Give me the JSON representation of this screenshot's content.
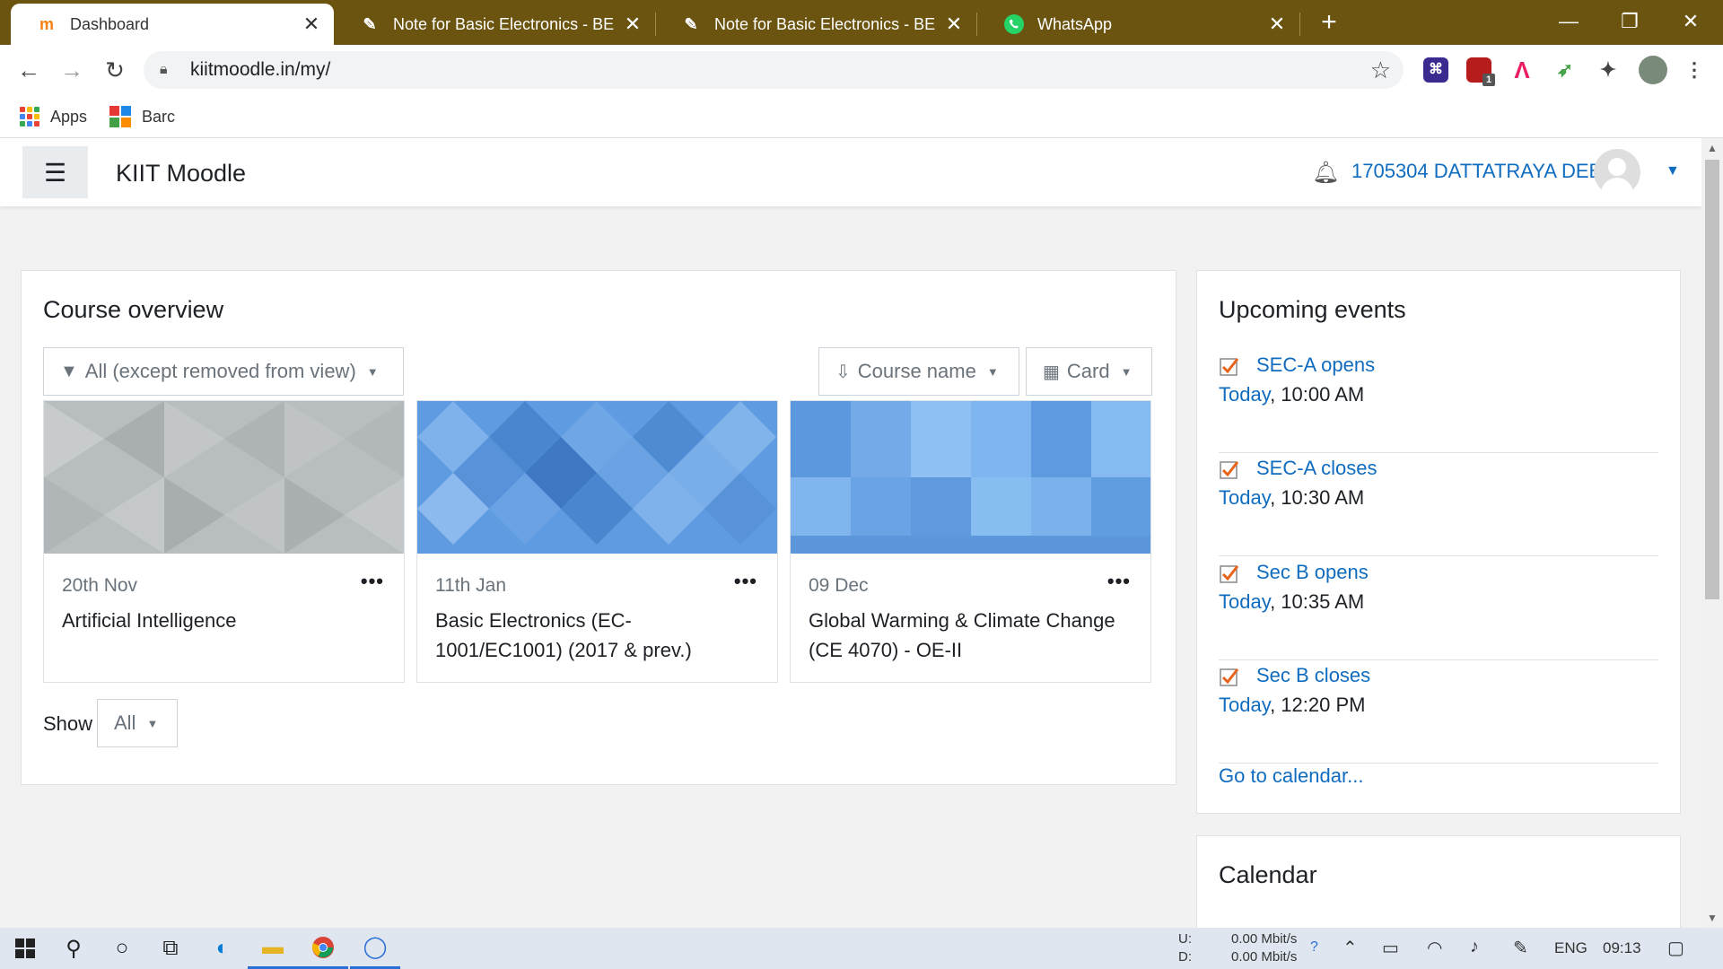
{
  "browser": {
    "tabs": [
      {
        "title": "Dashboard",
        "active": true
      },
      {
        "title": "Note for Basic Electronics - BE by",
        "active": false
      },
      {
        "title": "Note for Basic Electronics - BE By",
        "active": false
      },
      {
        "title": "WhatsApp",
        "active": false
      }
    ],
    "url": "kiitmoodle.in/my/",
    "bookmarks": [
      {
        "label": "Apps"
      },
      {
        "label": "Barc"
      }
    ],
    "extension_badge": "1"
  },
  "moodle": {
    "site_name": "KIIT Moodle",
    "user_name": "1705304 DATTATRAYA DEB"
  },
  "course_overview": {
    "title": "Course overview",
    "filter_label": "All (except removed from view)",
    "sort_label": "Course name",
    "view_label": "Card",
    "courses": [
      {
        "date": "20th Nov",
        "name": "Artificial Intelligence"
      },
      {
        "date": "11th Jan",
        "name": "Basic Electronics (EC-1001/EC1001) (2017 & prev.)"
      },
      {
        "date": "09 Dec",
        "name": "Global Warming & Climate Change (CE 4070) - OE-II"
      }
    ],
    "show_label": "Show",
    "show_value": "All"
  },
  "upcoming_events": {
    "title": "Upcoming events",
    "events": [
      {
        "name": "SEC-A opens",
        "day": "Today",
        "time": ", 10:00 AM"
      },
      {
        "name": "SEC-A closes",
        "day": "Today",
        "time": ", 10:30 AM"
      },
      {
        "name": "Sec B opens",
        "day": "Today",
        "time": ", 10:35 AM"
      },
      {
        "name": "Sec B closes",
        "day": "Today",
        "time": ", 12:20 PM"
      }
    ],
    "calendar_link": "Go to calendar..."
  },
  "calendar_block": {
    "title": "Calendar"
  },
  "taskbar": {
    "net_up_label": "U:",
    "net_down_label": "D:",
    "net_up": "0.00 Mbit/s",
    "net_down": "0.00 Mbit/s",
    "language": "ENG",
    "clock": "09:13"
  },
  "colors": {
    "tab_bar": "#6b5410",
    "link": "#0f6cbf",
    "taskbar": "#dfe6ef"
  }
}
